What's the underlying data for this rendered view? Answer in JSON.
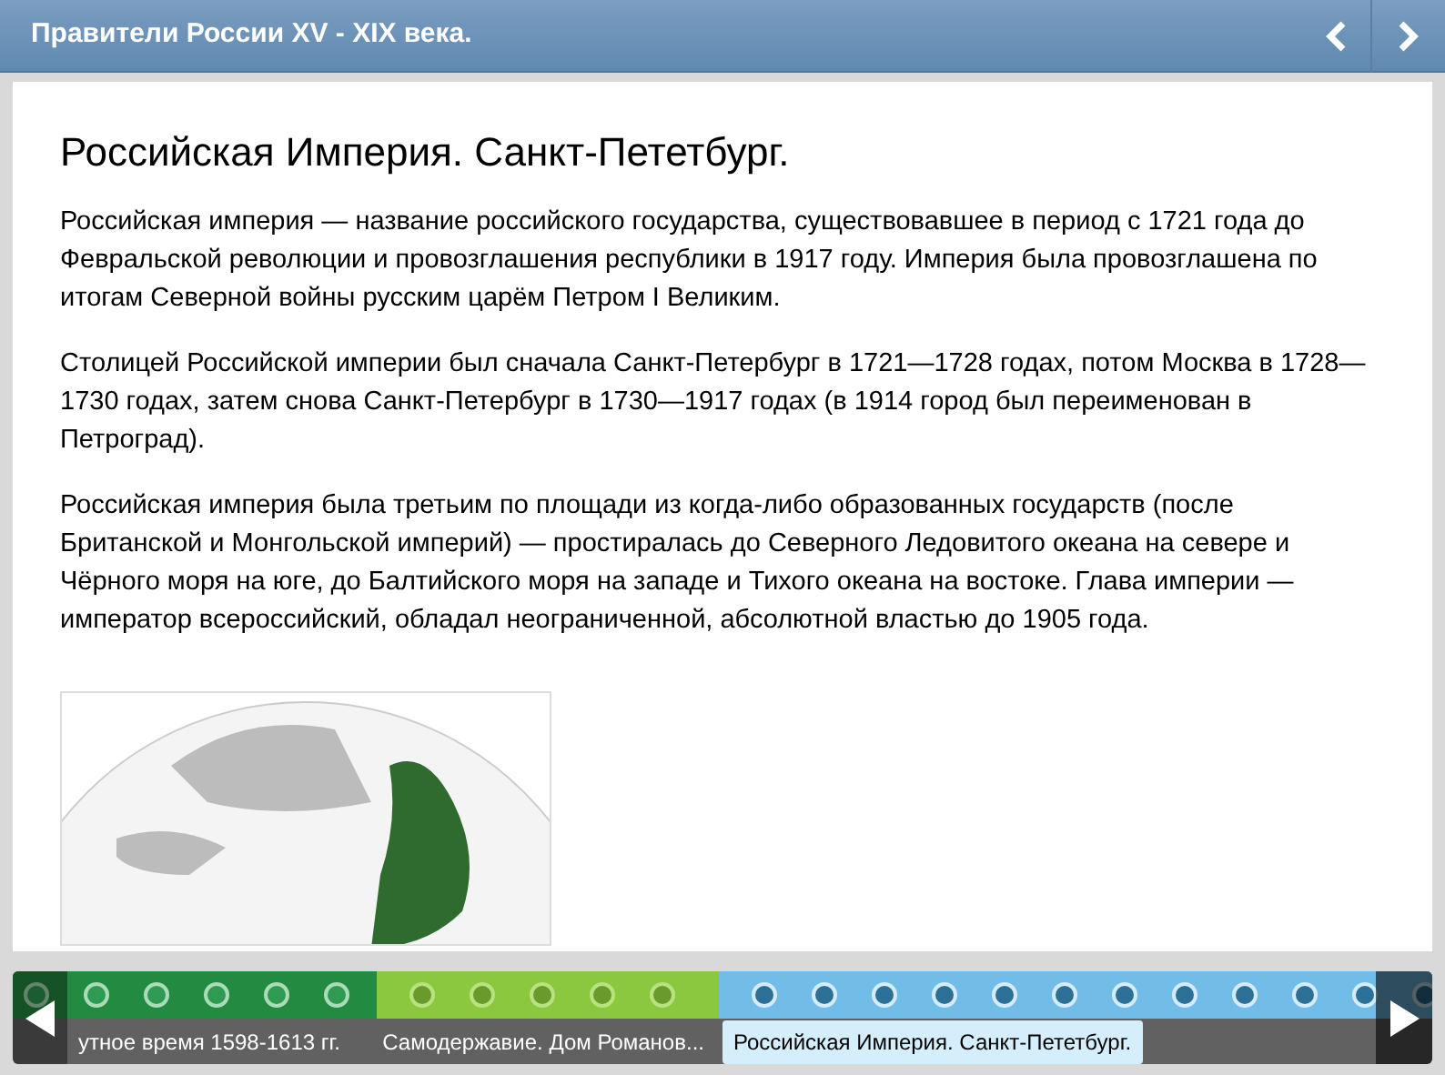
{
  "window": {
    "title": "Правители России XV - XIX века."
  },
  "article": {
    "heading": "Российская Империя. Санкт-Пететбург.",
    "paragraphs": [
      "Российская империя — название российского государства, существовавшее в период с 1721 года до Февральской революции и провозглашения республики в 1917 году. Империя была провозглашена по итогам Северной войны русским царём Петром I Великим.",
      "Столицей Российской империи был сначала Санкт-Петербург в 1721—1728 годах, потом Москва в 1728—1730 годах, затем снова Санкт-Петербург в 1730—1917 годах (в 1914 город был переименован в Петроград).",
      "Российская империя была третьим по площади из когда-либо образованных государств (после Британской и Монгольской империй) — простиралась до Северного Ледовитого океана на севере и Чёрного моря на юге, до Балтийского моря на западе и Тихого океана на востоке. Глава империи — император всероссийский, обладал неограниченной, абсолютной властью до 1905 года."
    ]
  },
  "timeline": {
    "eras": [
      {
        "label": "утное время 1598-1613 гг.",
        "color": "#238a42",
        "selected": false,
        "events": [
          {
            "selected": false
          },
          {
            "selected": false
          },
          {
            "selected": false
          },
          {
            "selected": false
          },
          {
            "selected": false
          },
          {
            "selected": false
          }
        ]
      },
      {
        "label": "Самодержавие. Дом Романов...",
        "color": "#8cc83f",
        "selected": false,
        "events": [
          {
            "selected": false
          },
          {
            "selected": false
          },
          {
            "selected": false
          },
          {
            "selected": false
          },
          {
            "selected": false
          }
        ]
      },
      {
        "label": "Российская Империя. Санкт-Пететбург.",
        "color": "#72bde8",
        "selected": true,
        "events": [
          {
            "selected": false
          },
          {
            "selected": false
          },
          {
            "selected": false
          },
          {
            "selected": false
          },
          {
            "selected": false
          },
          {
            "selected": false
          },
          {
            "selected": false
          },
          {
            "selected": false
          },
          {
            "selected": false
          },
          {
            "selected": false
          },
          {
            "selected": false
          },
          {
            "selected": false
          }
        ]
      }
    ]
  }
}
